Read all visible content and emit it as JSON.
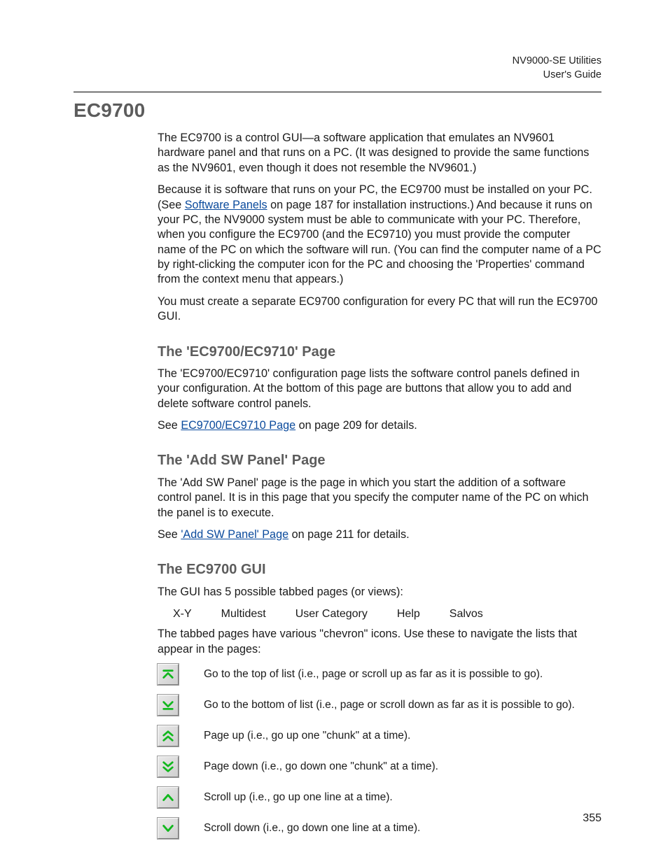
{
  "running_head": {
    "line1": "NV9000-SE Utilities",
    "line2": "User's Guide"
  },
  "h1": "EC9700",
  "intro": {
    "p1": "The EC9700 is a control GUI—a software application that emulates an NV9601 hardware panel and that runs on a PC. (It was designed to provide the same functions as the NV9601, even though it does not resemble the NV9601.)",
    "p2_pre": "Because it is software that runs on your PC, the EC9700 must be installed on your PC. (See ",
    "p2_link": "Software Panels",
    "p2_post": " on page 187 for installation instructions.) And because it runs on your PC, the NV9000 system must be able to communicate with your PC. Therefore, when you configure the EC9700 (and the EC9710) you must provide the computer name of the PC on which the software will run. (You can find the computer name of a PC by right-clicking the computer icon for the PC and choosing the 'Properties' command from the context menu that appears.)",
    "p3": "You must create a separate EC9700 configuration for every PC that will run the EC9700 GUI."
  },
  "sec1": {
    "heading": "The 'EC9700/EC9710' Page",
    "p1": "The 'EC9700/EC9710' configuration page lists the software control panels defined in your configuration. At the bottom of this page are buttons that allow you to add and delete software control panels.",
    "see_pre": "See ",
    "see_link": "EC9700/EC9710 Page",
    "see_post": " on page 209 for details."
  },
  "sec2": {
    "heading": "The 'Add SW Panel' Page",
    "p1": "The 'Add SW Panel' page is the page in which you start the addition of a software control panel. It is in this page that you specify the computer name of the PC on which the panel is to execute.",
    "see_pre": "See ",
    "see_link": "'Add SW Panel' Page",
    "see_post": " on page 211 for details."
  },
  "sec3": {
    "heading": "The EC9700 GUI",
    "p1": "The GUI has 5 possible tabbed pages (or views):",
    "tabs": [
      "X-Y",
      "Multidest",
      "User Category",
      "Help",
      "Salvos"
    ],
    "p2": "The tabbed pages have various \"chevron\" icons. Use these to navigate the lists that appear in the pages:",
    "icons": [
      {
        "name": "go-top-icon",
        "desc": "Go to the top of list (i.e., page or scroll up as far as it is possible to go)."
      },
      {
        "name": "go-bottom-icon",
        "desc": "Go to the bottom of list (i.e., page or scroll down as far as it is possible to go)."
      },
      {
        "name": "page-up-icon",
        "desc": "Page up (i.e., go up one \"chunk\" at a time)."
      },
      {
        "name": "page-down-icon",
        "desc": "Page down (i.e., go down one \"chunk\" at a time)."
      },
      {
        "name": "scroll-up-icon",
        "desc": "Scroll up (i.e., go up one line at a time)."
      },
      {
        "name": "scroll-down-icon",
        "desc": "Scroll down (i.e., go down one line at a time)."
      }
    ]
  },
  "page_number": "355"
}
